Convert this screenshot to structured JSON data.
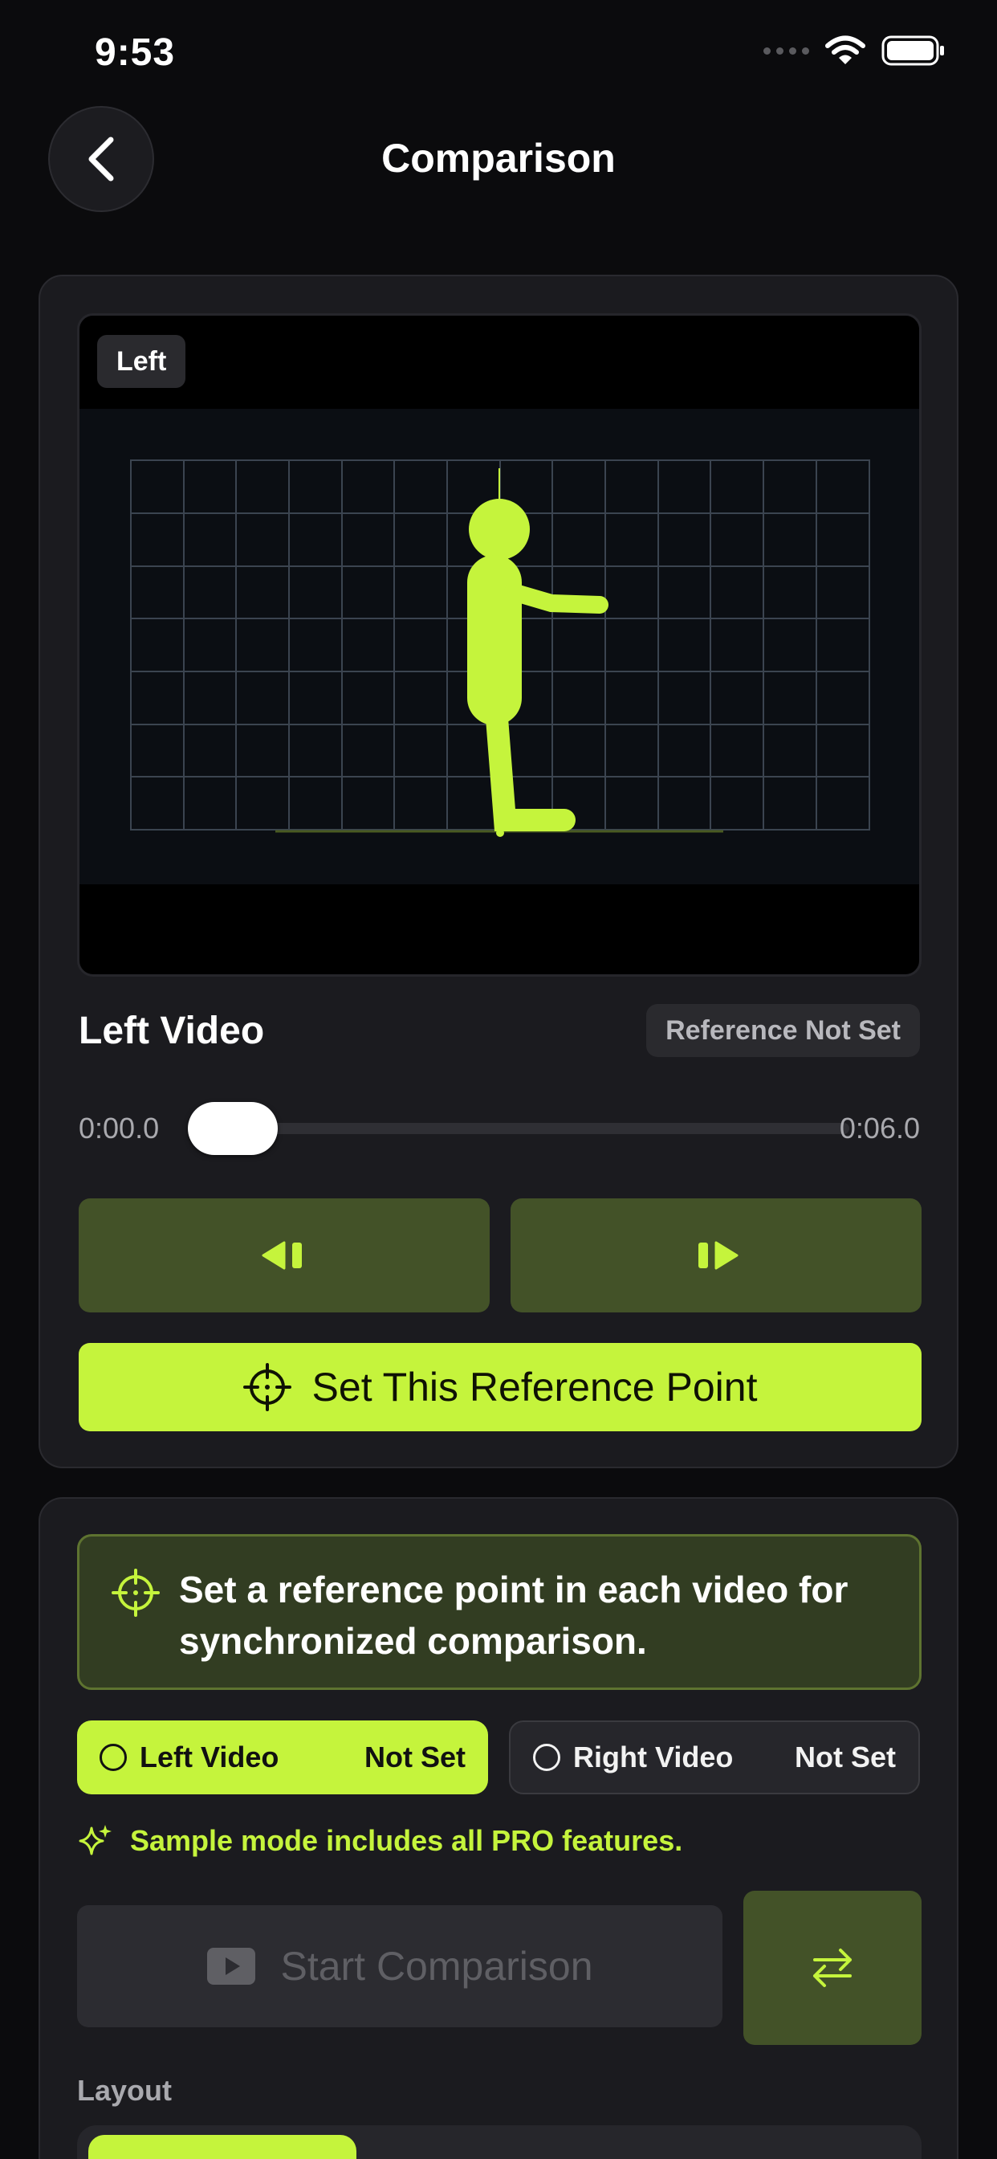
{
  "status_bar": {
    "time": "9:53"
  },
  "header": {
    "title": "Comparison"
  },
  "video": {
    "badge": "Left"
  },
  "controls": {
    "title": "Left Video",
    "reference_status": "Reference Not Set",
    "time_start": "0:00.0",
    "time_end": "0:06.0",
    "position": 0.0,
    "set_reference_label": "Set This Reference Point"
  },
  "sync": {
    "info": "Set a reference point in each video for synchronized comparison.",
    "left": {
      "label": "Left Video",
      "status": "Not Set"
    },
    "right": {
      "label": "Right Video",
      "status": "Not Set"
    },
    "pro_note": "Sample mode includes all PRO features.",
    "start_label": "Start Comparison",
    "layout_label": "Layout"
  },
  "colors": {
    "accent": "#c5f43c",
    "accent_dark": "#435228",
    "background": "#0b0b0d",
    "card": "#1b1b1f"
  },
  "icons": [
    "back-chevron-icon",
    "signal-icon",
    "wifi-icon",
    "battery-icon",
    "step-back-icon",
    "step-forward-icon",
    "crosshair-icon",
    "sparkle-icon",
    "play-icon",
    "swap-icon"
  ]
}
